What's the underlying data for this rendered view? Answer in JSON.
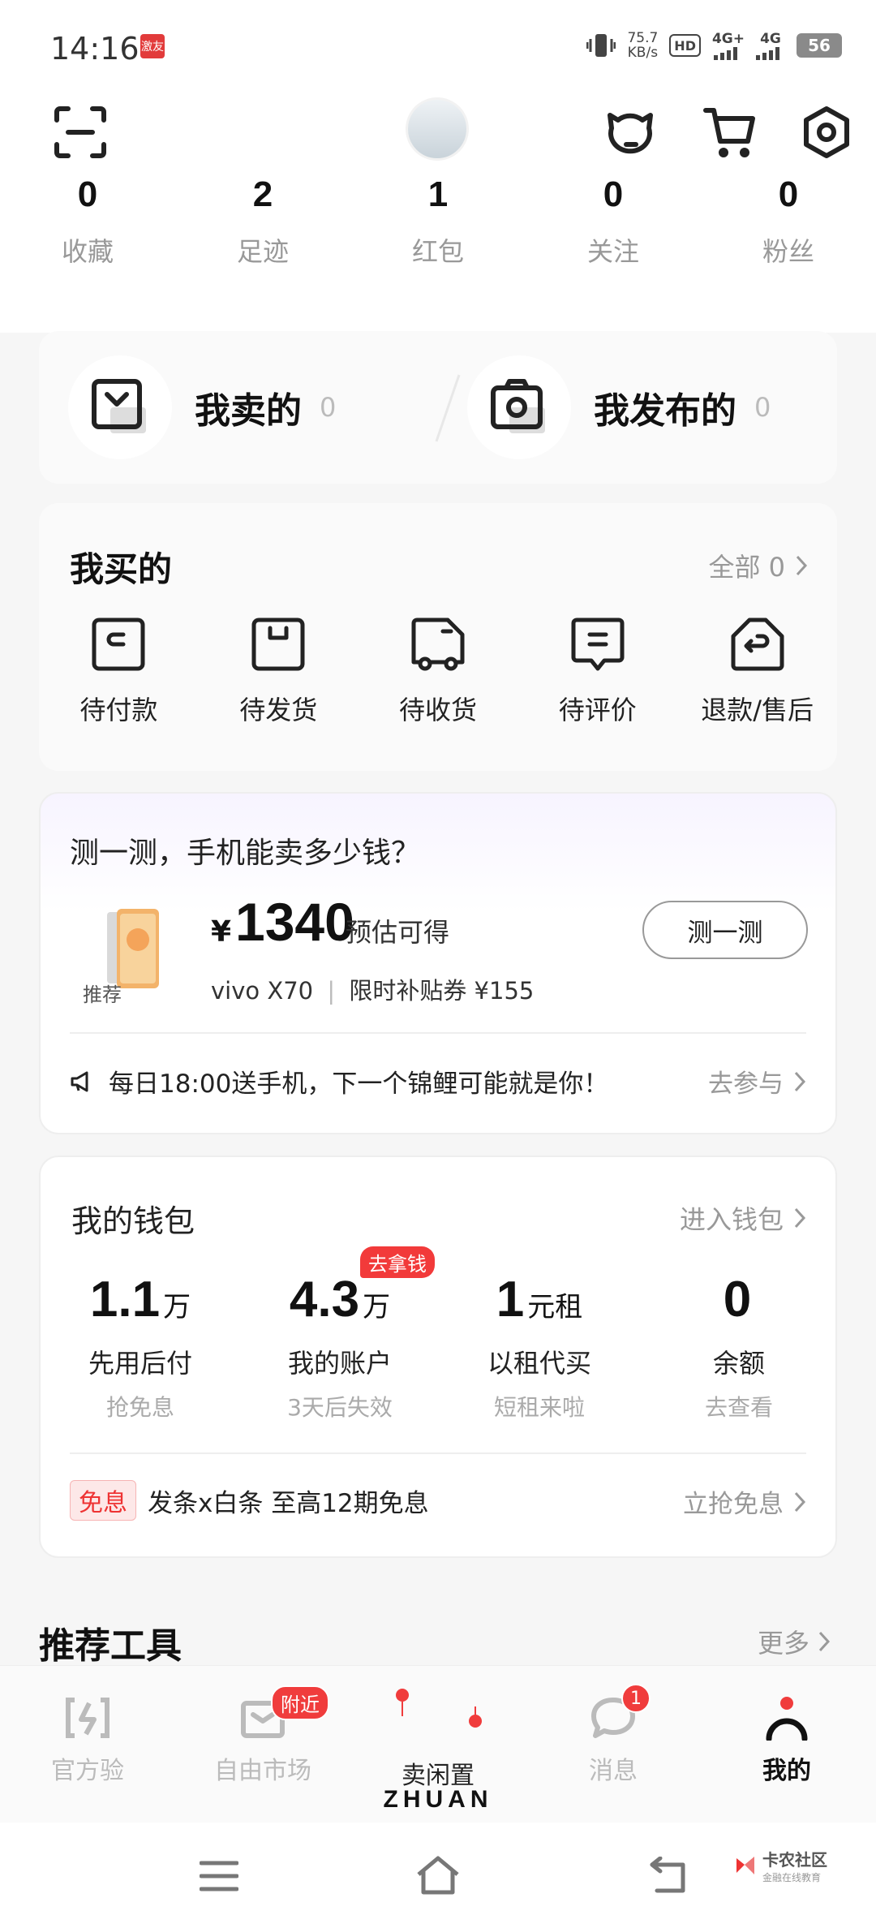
{
  "status_bar": {
    "time": "14:16",
    "app_badge": "激友",
    "speed_value": "75.7",
    "speed_unit": "KB/s",
    "hd_label": "HD",
    "net1": "4G+",
    "net2": "4G",
    "battery": "56"
  },
  "stats": [
    {
      "num": "0",
      "label": "收藏"
    },
    {
      "num": "2",
      "label": "足迹"
    },
    {
      "num": "1",
      "label": "红包"
    },
    {
      "num": "0",
      "label": "关注"
    },
    {
      "num": "0",
      "label": "粉丝"
    }
  ],
  "sell_publish": {
    "sold_label": "我卖的",
    "sold_count": "0",
    "published_label": "我发布的",
    "published_count": "0"
  },
  "bought": {
    "title": "我买的",
    "all_label": "全部 0",
    "items": [
      {
        "label": "待付款",
        "icon": "wallet-icon"
      },
      {
        "label": "待发货",
        "icon": "box-icon"
      },
      {
        "label": "待收货",
        "icon": "truck-icon"
      },
      {
        "label": "待评价",
        "icon": "comment-icon"
      },
      {
        "label": "退款/售后",
        "icon": "return-icon"
      }
    ]
  },
  "estimate": {
    "title": "测一测，手机能卖多少钱？",
    "currency": "¥",
    "price": "1340",
    "price_note": "预估可得",
    "thumb_label": "推荐",
    "model": "vivo X70",
    "coupon": "限时补贴券 ¥155",
    "button": "测一测",
    "promo_text": "每日18:00送手机，下一个锦鲤可能就是你！",
    "promo_action": "去参与"
  },
  "wallet": {
    "title": "我的钱包",
    "enter": "进入钱包",
    "columns": [
      {
        "num": "1.1",
        "unit": "万",
        "label": "先用后付",
        "sub": "抢免息"
      },
      {
        "num": "4.3",
        "unit": "万",
        "label": "我的账户",
        "sub": "3天后失效",
        "tag": "去拿钱"
      },
      {
        "num": "1",
        "unit": "元租",
        "label": "以租代买",
        "sub": "短租来啦"
      },
      {
        "num": "0",
        "unit": "",
        "label": "余额",
        "sub": "去查看"
      }
    ],
    "free_tag": "免息",
    "free_text": "发条x白条 至高12期免息",
    "free_action": "立抢免息"
  },
  "tools": {
    "title": "推荐工具",
    "more": "更多"
  },
  "tabbar": {
    "tabs": [
      {
        "label": "官方验"
      },
      {
        "label": "自由市场",
        "badge": "附近"
      },
      {
        "label": "卖闲置",
        "brand": "ZHUAN"
      },
      {
        "label": "消息",
        "badge": "1"
      },
      {
        "label": "我的"
      }
    ]
  },
  "watermark": {
    "main": "卡农社区",
    "sub": "金融在线教育"
  },
  "colors": {
    "accent_red": "#f03c3c",
    "muted": "#999999"
  }
}
